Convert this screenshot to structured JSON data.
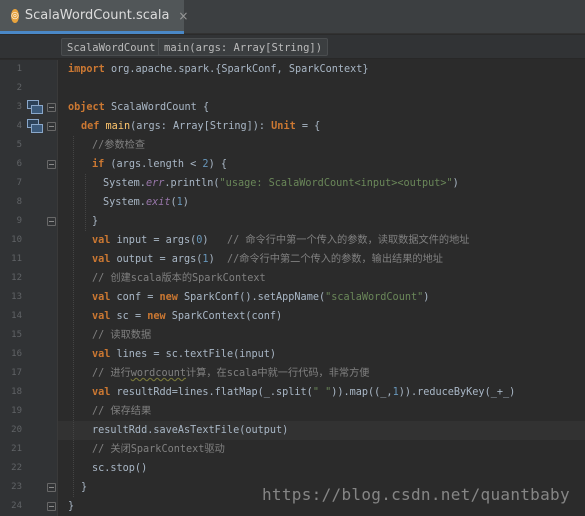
{
  "tab": {
    "icon": "scala-file-icon",
    "file_name": "ScalaWordCount.scala",
    "close_glyph": "×"
  },
  "breadcrumbs": [
    "ScalaWordCount",
    "main(args: Array[String])"
  ],
  "watermark": "https://blog.csdn.net/quantbaby",
  "colors": {
    "keyword": "#cc7832",
    "string": "#6a8759",
    "number": "#6897bb",
    "comment": "#808080",
    "function": "#ffc66d",
    "text": "#a9b7c6",
    "background": "#2b2b2b"
  },
  "highlighted_line": 20,
  "lines": [
    {
      "n": "1",
      "indent": 0,
      "parts": [
        [
          "kw",
          "import"
        ],
        [
          "t",
          " org.apache.spark.{SparkConf, SparkContext}"
        ]
      ]
    },
    {
      "n": "2",
      "indent": 0,
      "parts": []
    },
    {
      "n": "3",
      "indent": 0,
      "parts": [
        [
          "kw",
          "object"
        ],
        [
          "t",
          " ScalaWordCount {"
        ]
      ]
    },
    {
      "n": "4",
      "indent": 1,
      "parts": [
        [
          "kw",
          "def"
        ],
        [
          "t",
          " "
        ],
        [
          "fn",
          "main"
        ],
        [
          "t",
          "(args: Array[String]): "
        ],
        [
          "kw",
          "Unit"
        ],
        [
          "t",
          " = {"
        ]
      ]
    },
    {
      "n": "5",
      "indent": 2,
      "parts": [
        [
          "cm",
          "//参数检查"
        ]
      ]
    },
    {
      "n": "6",
      "indent": 2,
      "parts": [
        [
          "kw",
          "if"
        ],
        [
          "t",
          " (args.length < "
        ],
        [
          "num",
          "2"
        ],
        [
          "t",
          ") {"
        ]
      ]
    },
    {
      "n": "7",
      "indent": 3,
      "parts": [
        [
          "t",
          "System."
        ],
        [
          "it",
          "err"
        ],
        [
          "t",
          ".println("
        ],
        [
          "str",
          "\"usage: ScalaWordCount<input><output>\""
        ],
        [
          "t",
          ")"
        ]
      ]
    },
    {
      "n": "8",
      "indent": 3,
      "parts": [
        [
          "t",
          "System."
        ],
        [
          "it",
          "exit"
        ],
        [
          "t",
          "("
        ],
        [
          "num",
          "1"
        ],
        [
          "t",
          ")"
        ]
      ]
    },
    {
      "n": "9",
      "indent": 2,
      "parts": [
        [
          "t",
          "}"
        ]
      ]
    },
    {
      "n": "10",
      "indent": 2,
      "parts": [
        [
          "kw",
          "val"
        ],
        [
          "t",
          " input = args("
        ],
        [
          "num",
          "0"
        ],
        [
          "t",
          ")   "
        ],
        [
          "cm",
          "// 命令行中第一个传入的参数，读取数据文件的地址"
        ]
      ]
    },
    {
      "n": "11",
      "indent": 2,
      "parts": [
        [
          "kw",
          "val"
        ],
        [
          "t",
          " output = args("
        ],
        [
          "num",
          "1"
        ],
        [
          "t",
          ")  "
        ],
        [
          "cm",
          "//命令行中第二个传入的参数，输出结果的地址"
        ]
      ]
    },
    {
      "n": "12",
      "indent": 2,
      "parts": [
        [
          "cm",
          "// 创建scala版本的SparkContext"
        ]
      ]
    },
    {
      "n": "13",
      "indent": 2,
      "parts": [
        [
          "kw",
          "val"
        ],
        [
          "t",
          " conf = "
        ],
        [
          "kw",
          "new"
        ],
        [
          "t",
          " SparkConf().setAppName("
        ],
        [
          "str",
          "\"scalaWordCount\""
        ],
        [
          "t",
          ")"
        ]
      ]
    },
    {
      "n": "14",
      "indent": 2,
      "parts": [
        [
          "kw",
          "val"
        ],
        [
          "t",
          " sc = "
        ],
        [
          "kw",
          "new"
        ],
        [
          "t",
          " SparkContext(conf)"
        ]
      ]
    },
    {
      "n": "15",
      "indent": 2,
      "parts": [
        [
          "cm",
          "// 读取数据"
        ]
      ]
    },
    {
      "n": "16",
      "indent": 2,
      "parts": [
        [
          "kw",
          "val"
        ],
        [
          "t",
          " lines = sc.textFile(input)"
        ]
      ]
    },
    {
      "n": "17",
      "indent": 2,
      "parts": [
        [
          "cm",
          "// 进行"
        ],
        [
          "cmw",
          "wordcount"
        ],
        [
          "cm",
          "计算，在scala中就一行代码，非常方便"
        ]
      ]
    },
    {
      "n": "18",
      "indent": 2,
      "parts": [
        [
          "kw",
          "val"
        ],
        [
          "t",
          " resultRdd=lines.flatMap(_.split("
        ],
        [
          "str",
          "\" \""
        ],
        [
          "t",
          ")).map((_,"
        ],
        [
          "num",
          "1"
        ],
        [
          "t",
          ")).reduceByKey(_+_)"
        ]
      ]
    },
    {
      "n": "19",
      "indent": 2,
      "parts": [
        [
          "cm",
          "// 保存结果"
        ]
      ]
    },
    {
      "n": "20",
      "indent": 2,
      "parts": [
        [
          "t",
          "resultRdd.saveAsTextFile(output)"
        ]
      ]
    },
    {
      "n": "21",
      "indent": 2,
      "parts": [
        [
          "cm",
          "// 关闭SparkContext驱动"
        ]
      ]
    },
    {
      "n": "22",
      "indent": 2,
      "parts": [
        [
          "t",
          "sc.stop()"
        ]
      ]
    },
    {
      "n": "23",
      "indent": 1,
      "parts": [
        [
          "t",
          "}"
        ]
      ]
    },
    {
      "n": "24",
      "indent": 0,
      "parts": [
        [
          "t",
          "}"
        ]
      ]
    }
  ]
}
